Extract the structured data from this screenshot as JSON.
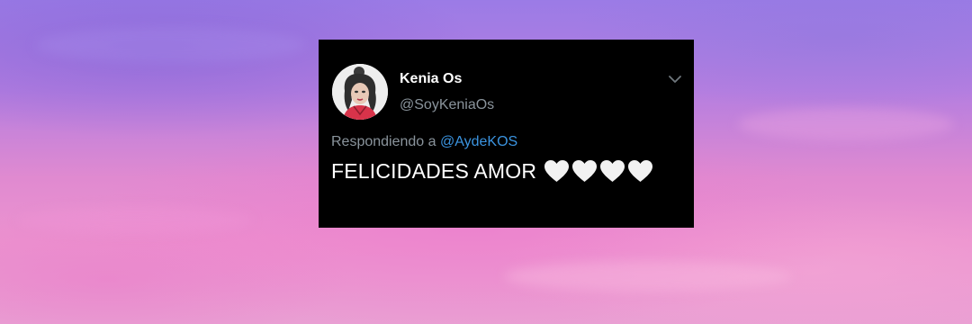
{
  "colors": {
    "card_background": "#000000",
    "name": "#ffffff",
    "secondary_text": "#8a949c",
    "mention": "#3b94e0",
    "heart": "#f2f2f2"
  },
  "tweet": {
    "display_name": "Kenia Os",
    "handle": "@SoyKeniaOs",
    "reply_prefix": "Respondiendo a",
    "reply_to": "@AydeKOS",
    "text": "FELICIDADES AMOR",
    "emoji": [
      "white-heart-icon",
      "white-heart-icon",
      "white-heart-icon",
      "white-heart-icon"
    ],
    "menu_icon": "chevron-down-icon",
    "avatar_icon": "profile-photo"
  }
}
